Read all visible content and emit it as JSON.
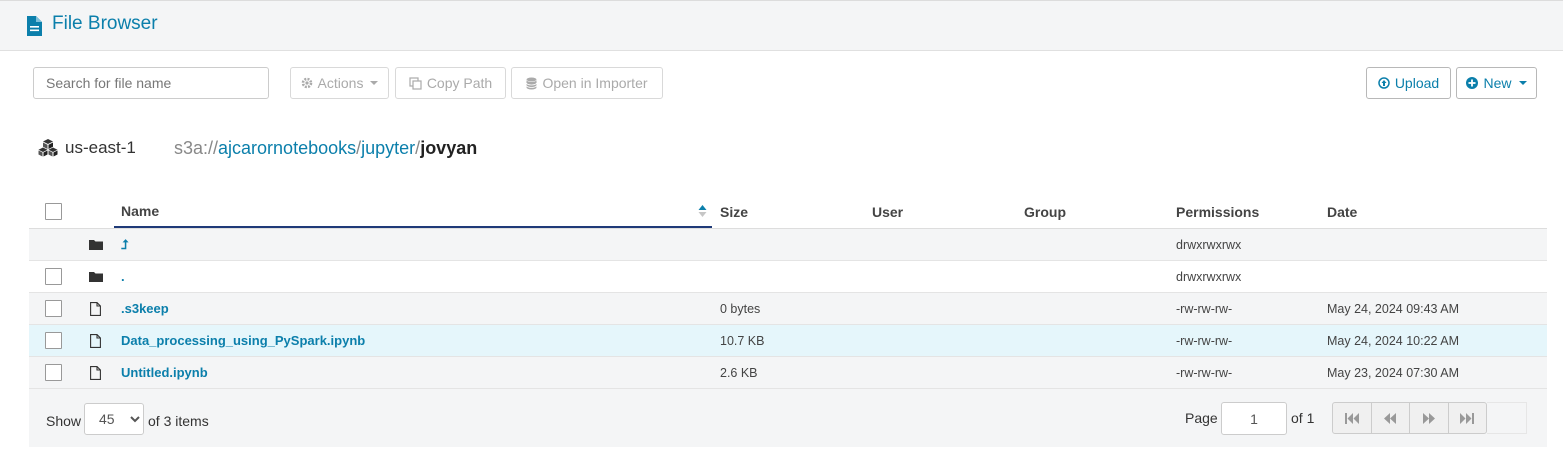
{
  "header": {
    "title": "File Browser",
    "icon": "file-document-icon"
  },
  "toolbar": {
    "search_placeholder": "Search for file name",
    "actions_label": "Actions",
    "copy_path_label": "Copy Path",
    "open_importer_label": "Open in Importer",
    "upload_label": "Upload",
    "new_label": "New"
  },
  "location": {
    "region": "us-east-1",
    "scheme": "s3a://",
    "segments": [
      "ajcarornotebooks",
      "jupyter"
    ],
    "current": "jovyan",
    "separator": "/"
  },
  "table": {
    "headers": {
      "name": "Name",
      "size": "Size",
      "user": "User",
      "group": "Group",
      "permissions": "Permissions",
      "date": "Date"
    },
    "sort": {
      "column": "Name",
      "direction": "ascending"
    },
    "rows": [
      {
        "type": "folder",
        "name": "⮥",
        "size": "",
        "user": "",
        "group": "",
        "permissions": "drwxrwxrwx",
        "date": ""
      },
      {
        "type": "folder",
        "name": ".",
        "size": "",
        "user": "",
        "group": "",
        "permissions": "drwxrwxrwx",
        "date": ""
      },
      {
        "type": "file",
        "name": ".s3keep",
        "size": "0 bytes",
        "user": "",
        "group": "",
        "permissions": "-rw-rw-rw-",
        "date": "May 24, 2024 09:43 AM"
      },
      {
        "type": "file",
        "name": "Data_processing_using_PySpark.ipynb",
        "size": "10.7 KB",
        "user": "",
        "group": "",
        "permissions": "-rw-rw-rw-",
        "date": "May 24, 2024 10:22 AM"
      },
      {
        "type": "file",
        "name": "Untitled.ipynb",
        "size": "2.6 KB",
        "user": "",
        "group": "",
        "permissions": "-rw-rw-rw-",
        "date": "May 23, 2024 07:30 AM"
      }
    ]
  },
  "footer": {
    "show_label": "Show",
    "page_size": "45",
    "of_items": "of 3 items",
    "page_label": "Page",
    "page_value": "1",
    "of_pages": "of 1"
  },
  "colors": {
    "accent": "#0b7fab",
    "header_bg": "#f4f5f6",
    "highlight_row": "#e5f6fb"
  }
}
